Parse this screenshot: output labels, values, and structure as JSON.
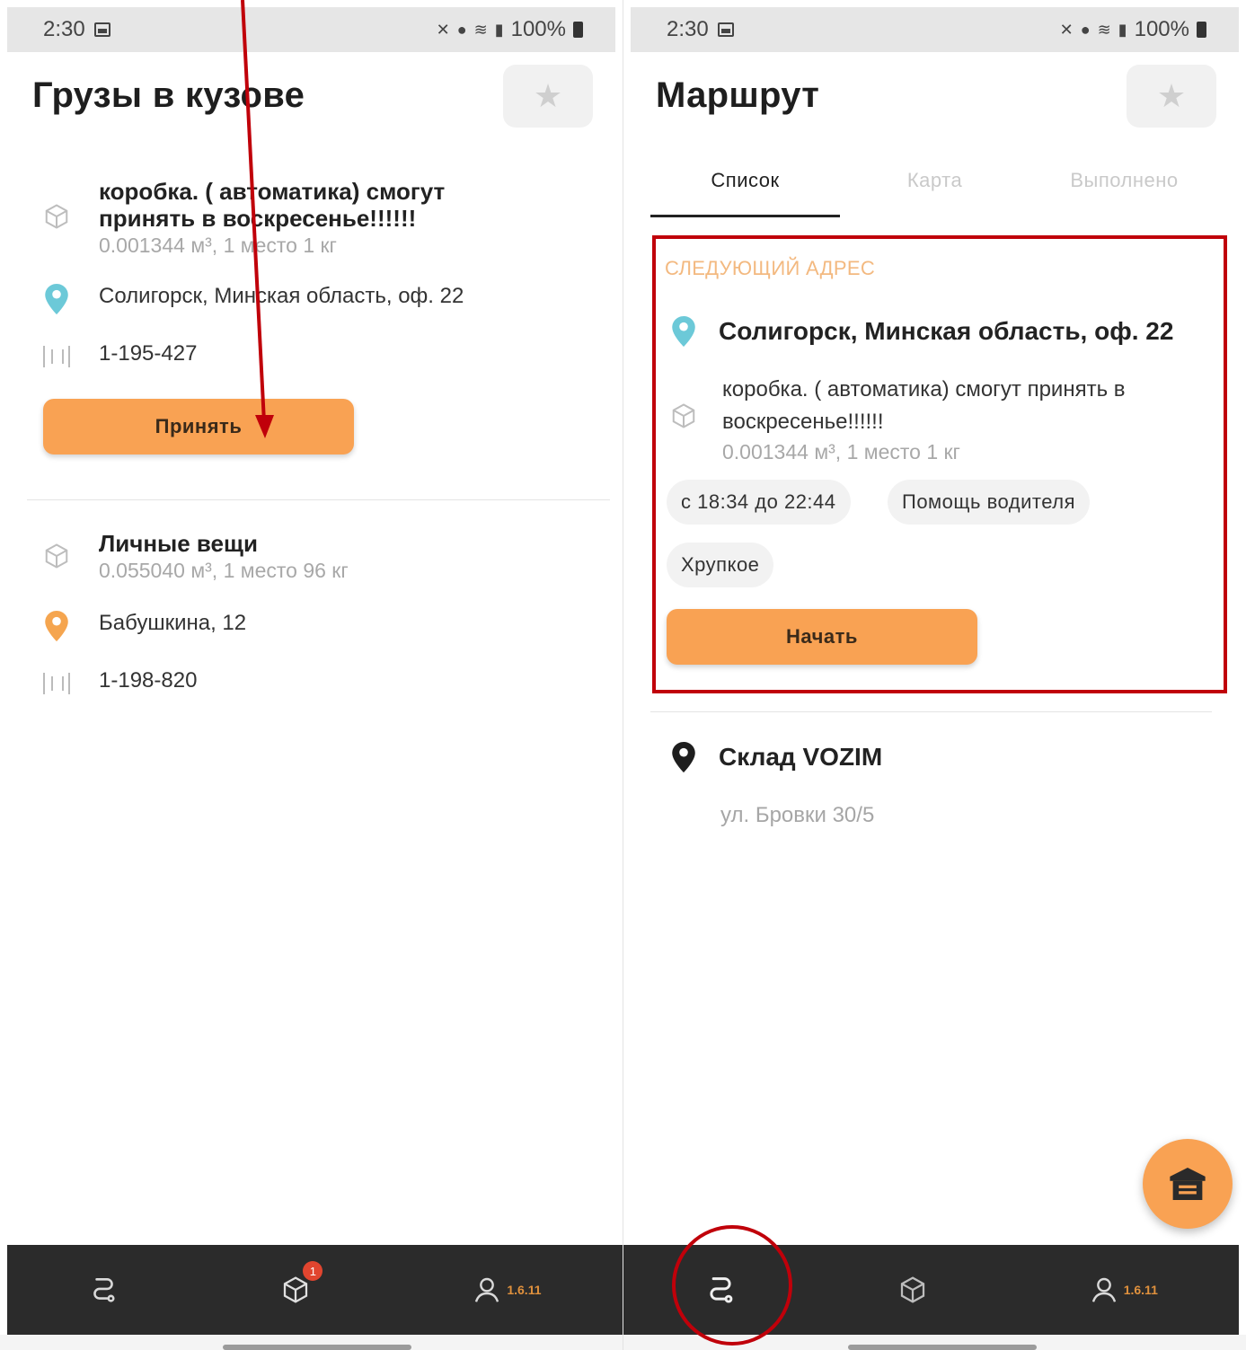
{
  "statusbar": {
    "time": "2:30",
    "battery": "100%"
  },
  "left": {
    "title": "Грузы в кузове",
    "cargo": [
      {
        "title": "коробка. ( автоматика) смогут принять в воскресенье!!!!!!",
        "meta": "0.001344 м³, 1 место 1 кг",
        "address": "Солигорск, Минская область, оф. 22",
        "code": "1-195-427",
        "button": "Принять"
      },
      {
        "title": "Личные вещи",
        "meta": "0.055040 м³, 1 место 96 кг",
        "address": "Бабушкина, 12",
        "code": "1-198-820"
      }
    ],
    "nav": {
      "badge": "1",
      "version": "1.6.11"
    }
  },
  "right": {
    "title": "Маршрут",
    "tabs": [
      "Список",
      "Карта",
      "Выполнено"
    ],
    "next": {
      "label": "СЛЕДУЮЩИЙ АДРЕС",
      "address": "Солигорск, Минская область, оф. 22",
      "cargo_title": "коробка. ( автоматика) смогут принять в воскресенье!!!!!!",
      "cargo_meta": "0.001344 м³, 1 место 1 кг",
      "chips": [
        "с 18:34 до 22:44",
        "Помощь водителя",
        "Хрупкое"
      ],
      "button": "Начать"
    },
    "warehouse": {
      "name": "Склад VOZIM",
      "address": "ул. Бровки 30/5"
    },
    "nav": {
      "version": "1.6.11"
    }
  },
  "colors": {
    "accent": "#f9a253",
    "pin_blue": "#6cc9d8",
    "pin_orange": "#f5a54f",
    "annotation": "#c0000a",
    "nav_bg": "#2b2b2b"
  }
}
